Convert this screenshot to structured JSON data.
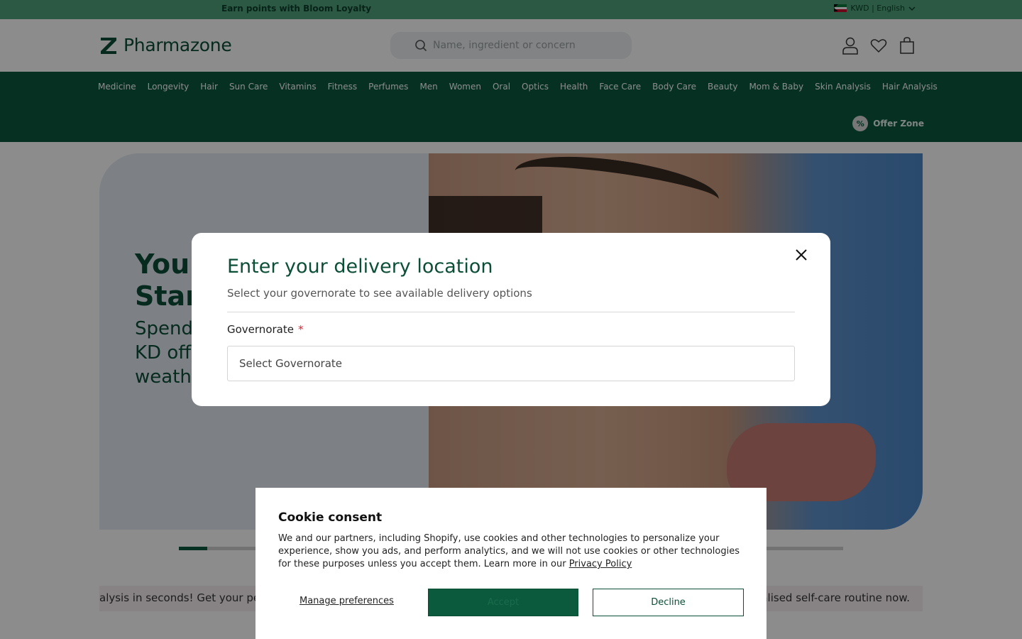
{
  "topbar": {
    "promo": "Earn points with Bloom Loyalty",
    "locale": "KWD | English"
  },
  "header": {
    "logo_text": "Pharmazone",
    "search_placeholder": "Name, ingredient or concern"
  },
  "nav": {
    "items": [
      "Medicine",
      "Longevity",
      "Hair",
      "Sun Care",
      "Vitamins",
      "Fitness",
      "Perfumes",
      "Men",
      "Women",
      "Oral",
      "Optics",
      "Health",
      "Face Care",
      "Body Care",
      "Beauty",
      "Mom & Baby",
      "Skin Analysis",
      "Hair Analysis"
    ],
    "offer_zone": "Offer Zone",
    "offer_badge": "%"
  },
  "hero": {
    "title_line1": "Your",
    "title_line2": "Start",
    "sub_line1": "Spend",
    "sub_line2": "KD off",
    "sub_line3": "weathe"
  },
  "carousel": {
    "progress": 0.043
  },
  "marquee": {
    "left_text": "alysis in seconds! Get your pe",
    "right_text": "alised self-care routine now."
  },
  "modal": {
    "title": "Enter your delivery location",
    "description": "Select your governorate to see available delivery options",
    "field_label": "Governorate",
    "required_mark": "*",
    "select_placeholder": "Select Governorate"
  },
  "cookie": {
    "title": "Cookie consent",
    "body": "We and our partners, including Shopify, use cookies and other technologies to personalize your experience, show you ads, and perform analytics, and we will not use cookies or other technologies for these purposes unless you accept them. Learn more in our ",
    "privacy_link": "Privacy Policy",
    "manage": "Manage preferences",
    "accept": "Accept",
    "decline": "Decline"
  },
  "colors": {
    "brand_green": "#0b5a3e",
    "topbar_green": "#4fa27a",
    "overlay": "rgba(0,0,0,0.45)"
  }
}
